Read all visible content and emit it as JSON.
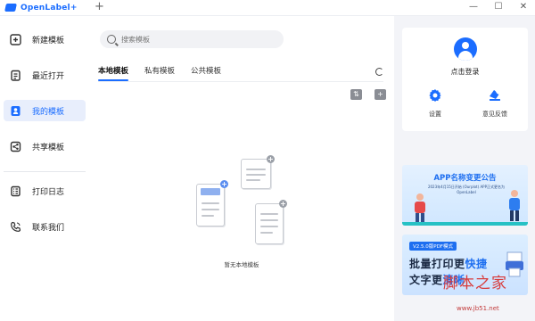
{
  "app": {
    "title": "OpenLabel+"
  },
  "window": {
    "new_tab": "+",
    "minimize": "—",
    "maximize": "☐",
    "close": "✕"
  },
  "sidebar": {
    "items": [
      {
        "label": "新建模板",
        "icon": "plus-square-icon"
      },
      {
        "label": "最近打开",
        "icon": "clipboard-icon"
      },
      {
        "label": "我的模板",
        "icon": "user-template-icon",
        "active": true
      },
      {
        "label": "共享模板",
        "icon": "share-icon"
      },
      {
        "label": "打印日志",
        "icon": "log-icon"
      },
      {
        "label": "联系我们",
        "icon": "phone-icon"
      }
    ]
  },
  "main": {
    "search_placeholder": "搜索模板",
    "tabs": [
      {
        "label": "本地模板",
        "active": true
      },
      {
        "label": "私有模板"
      },
      {
        "label": "公共模板"
      }
    ],
    "empty_text": "暂无本地模板"
  },
  "user_card": {
    "login_label": "点击登录",
    "settings_label": "设置",
    "feedback_label": "意见反馈"
  },
  "banners": {
    "rename": {
      "title": "APP名称变更公告",
      "subtitle": "2023年4月15日开始 (Ourplot) APP正式更名为OpenLabel"
    },
    "pdf": {
      "tag": "V2.5.0版PDF模式",
      "line1_a": "批量打印更",
      "line1_b": "快捷",
      "line2_a": "文字更",
      "line2_b": "清晰"
    }
  },
  "watermark": {
    "text": "脚本之家",
    "url": "www.jb51.net"
  },
  "colors": {
    "accent": "#1b6dff",
    "active_bg": "#e8eefc",
    "watermark": "#d83b3b"
  }
}
